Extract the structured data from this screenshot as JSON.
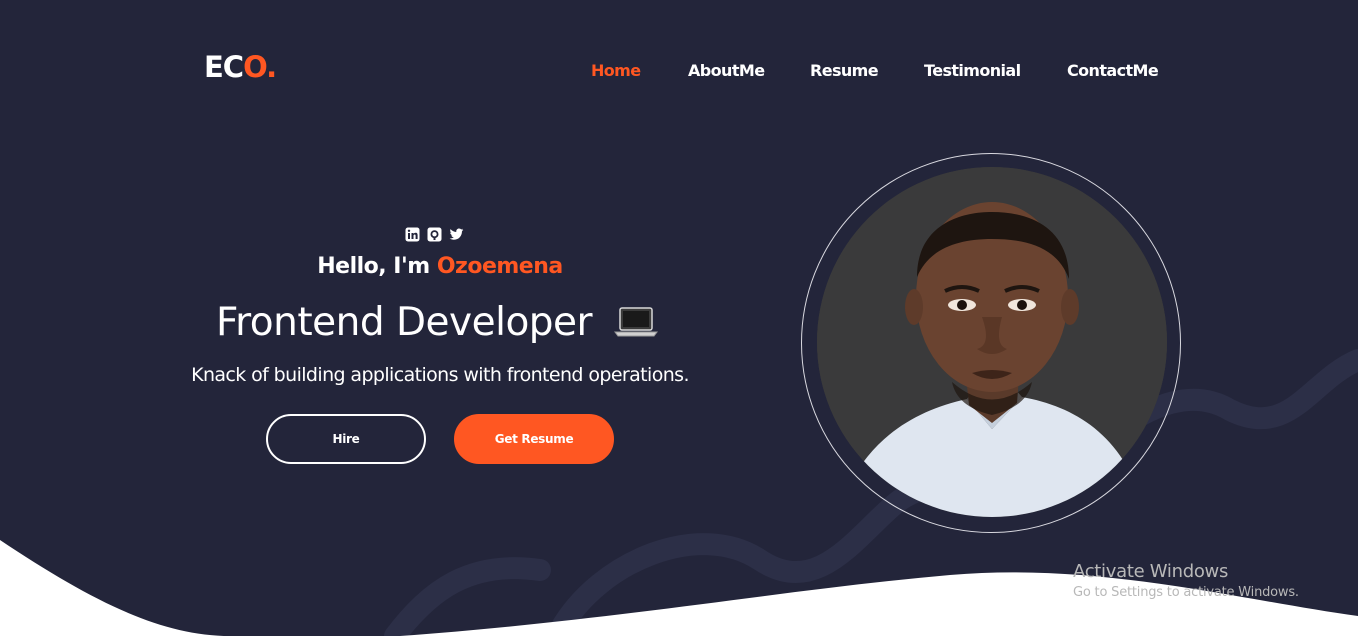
{
  "brand": {
    "logo_main": "EC",
    "logo_accent": "O."
  },
  "nav": {
    "items": [
      {
        "label": "Home",
        "active": true
      },
      {
        "label": "AboutMe"
      },
      {
        "label": "Resume"
      },
      {
        "label": "Testimonial"
      },
      {
        "label": "ContactMe"
      }
    ]
  },
  "hero": {
    "socials": [
      "linkedin-icon",
      "github-icon",
      "twitter-icon"
    ],
    "greeting_prefix": "Hello, I'm ",
    "name": "Ozoemena",
    "role": "Frontend Developer",
    "role_emoji": "laptop-icon",
    "tagline": "Knack of building applications with frontend operations.",
    "hire_label": "Hire",
    "resume_label": "Get Resume"
  },
  "watermark": {
    "line1": "Activate Windows",
    "line2": "Go to Settings to activate Windows."
  },
  "colors": {
    "background": "#23253a",
    "accent": "#ff5722",
    "text": "#ffffff",
    "bottom_surface": "#ffffff"
  }
}
